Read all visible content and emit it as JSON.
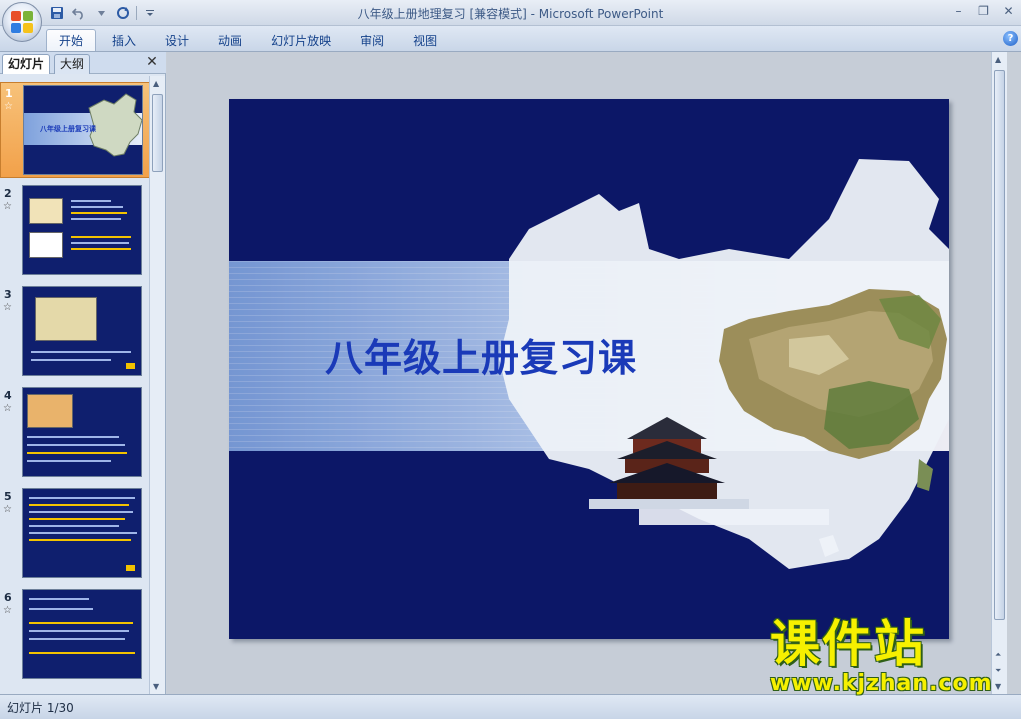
{
  "window": {
    "title": "八年级上册地理复习 [兼容模式] - Microsoft PowerPoint",
    "minimize_label": "–",
    "restore_label": "❐",
    "close_label": "✕"
  },
  "ribbon": {
    "tabs": [
      {
        "label": "开始",
        "active": true
      },
      {
        "label": "插入"
      },
      {
        "label": "设计"
      },
      {
        "label": "动画"
      },
      {
        "label": "幻灯片放映"
      },
      {
        "label": "审阅"
      },
      {
        "label": "视图"
      }
    ],
    "help_label": "?"
  },
  "left_panel": {
    "tab_slides": "幻灯片",
    "tab_outline": "大纲",
    "close_label": "✕",
    "thumbnails": [
      {
        "number": "1",
        "title": "八年级上册复习课",
        "selected": true
      },
      {
        "number": "2"
      },
      {
        "number": "3"
      },
      {
        "number": "4"
      },
      {
        "number": "5"
      },
      {
        "number": "6"
      }
    ],
    "star_glyph": "☆"
  },
  "slide": {
    "title": "八年级上册复习课"
  },
  "status": {
    "text": "幻灯片 1/30"
  },
  "watermark": {
    "cn": "课件站",
    "url": "www.kjzhan.com"
  },
  "colors": {
    "slide_bg": "#0c1767",
    "title_text": "#1a3ab8",
    "selection": "#f2a14a",
    "watermark": "#f6f000"
  }
}
